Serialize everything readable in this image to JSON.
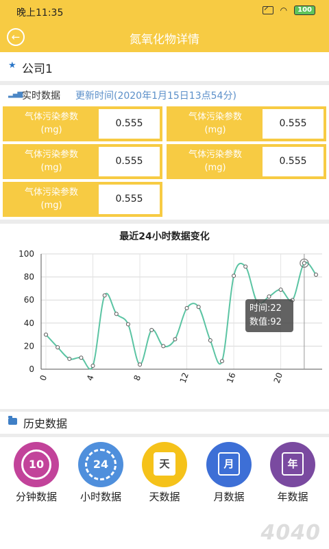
{
  "status": {
    "time": "晚上11:35",
    "battery": "100"
  },
  "header": {
    "title": "氮氧化物详情"
  },
  "company": {
    "name": "公司1"
  },
  "realtime": {
    "label": "实时数据",
    "updated": "更新时间(2020年1月15日13点54分)",
    "params": [
      {
        "label": "气体污染参数\n(mg)",
        "value": "0.555"
      },
      {
        "label": "气体污染参数\n(mg)",
        "value": "0.555"
      },
      {
        "label": "气体污染参数\n(mg)",
        "value": "0.555"
      },
      {
        "label": "气体污染参数\n(mg)",
        "value": "0.555"
      },
      {
        "label": "气体污染参数\n(mg)",
        "value": "0.555"
      }
    ]
  },
  "chart_data": {
    "type": "line",
    "title": "最近24小时数据变化",
    "x": [
      0,
      1,
      2,
      3,
      4,
      5,
      6,
      7,
      8,
      9,
      10,
      11,
      12,
      13,
      14,
      15,
      16,
      17,
      18,
      19,
      20,
      21,
      22,
      23
    ],
    "values": [
      30,
      19,
      9,
      10,
      3,
      64,
      48,
      39,
      4,
      34,
      20,
      26,
      53,
      54,
      25,
      7,
      81,
      89,
      58,
      63,
      69,
      60,
      92,
      82
    ],
    "xticks": [
      0,
      4,
      8,
      12,
      16,
      20
    ],
    "yticks": [
      0,
      20,
      40,
      60,
      80,
      100
    ],
    "xlim": [
      0,
      23
    ],
    "ylim": [
      0,
      100
    ],
    "line_color": "#5bc4a3",
    "grid": true,
    "tooltip": {
      "time_label": "时间:22",
      "value_label": "数值:92",
      "index": 22
    }
  },
  "history": {
    "label": "历史数据",
    "items": [
      {
        "label": "分钟数据",
        "icon": "minute-clock-icon",
        "glyph": "10",
        "color": "#c2439a"
      },
      {
        "label": "小时数据",
        "icon": "hour-cycle-icon",
        "glyph": "24",
        "color": "#4f8fdc"
      },
      {
        "label": "天数据",
        "icon": "day-calendar-icon",
        "glyph": "天",
        "color": "#f5c21a"
      },
      {
        "label": "月数据",
        "icon": "month-calendar-icon",
        "glyph": "月",
        "color": "#3d6fd6"
      },
      {
        "label": "年数据",
        "icon": "year-calendar-icon",
        "glyph": "年",
        "color": "#7a4aa0"
      }
    ]
  },
  "watermark": "4040"
}
